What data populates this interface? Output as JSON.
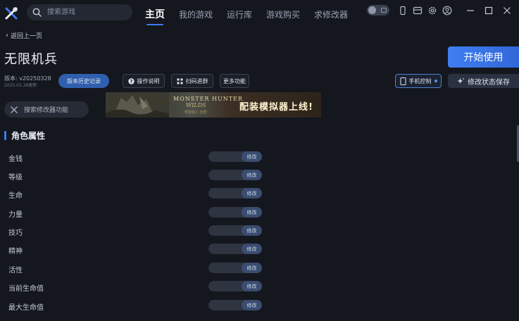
{
  "search": {
    "placeholder": "搜索游戏"
  },
  "nav": [
    "主页",
    "我的游戏",
    "运行库",
    "游戏购买",
    "求修改器"
  ],
  "back_label": "返回上一页",
  "game": {
    "title": "无限机兵",
    "version": "版本: v20250328",
    "updated": "2025.03.28更新"
  },
  "buttons": {
    "start": "开始使用",
    "history": "版本历史记录",
    "guide": "操作说明",
    "scan": "扫码进群",
    "more": "更多功能",
    "phone": "手机控制",
    "save_state": "修改状态保存"
  },
  "search_mod": {
    "label": "搜索修改器功能"
  },
  "banner": {
    "line1": "MONSTER HUNTER",
    "line2": "WILDS",
    "line3": "怪物猎人 荒野",
    "cta": "配装模拟器上线!"
  },
  "section": {
    "title": "角色属性"
  },
  "attributes": [
    {
      "label": "金钱",
      "action": "修改"
    },
    {
      "label": "等级",
      "action": "修改"
    },
    {
      "label": "生命",
      "action": "修改"
    },
    {
      "label": "力量",
      "action": "修改"
    },
    {
      "label": "技巧",
      "action": "修改"
    },
    {
      "label": "精神",
      "action": "修改"
    },
    {
      "label": "活性",
      "action": "修改"
    },
    {
      "label": "当前生命值",
      "action": "修改"
    },
    {
      "label": "最大生命值",
      "action": "修改"
    }
  ],
  "colors": {
    "accent": "#3c7cf0",
    "background": "#14171e",
    "start_button": "#3f7ff2"
  },
  "icons": [
    "app-logo-icon",
    "search-icon",
    "toggle-icon",
    "phone-icon",
    "window-icon",
    "gear-icon",
    "user-icon",
    "minimize-icon",
    "maximize-icon",
    "close-icon",
    "question-icon",
    "grid-icon",
    "tablet-icon",
    "sparkle-icon",
    "wrench-icon"
  ]
}
